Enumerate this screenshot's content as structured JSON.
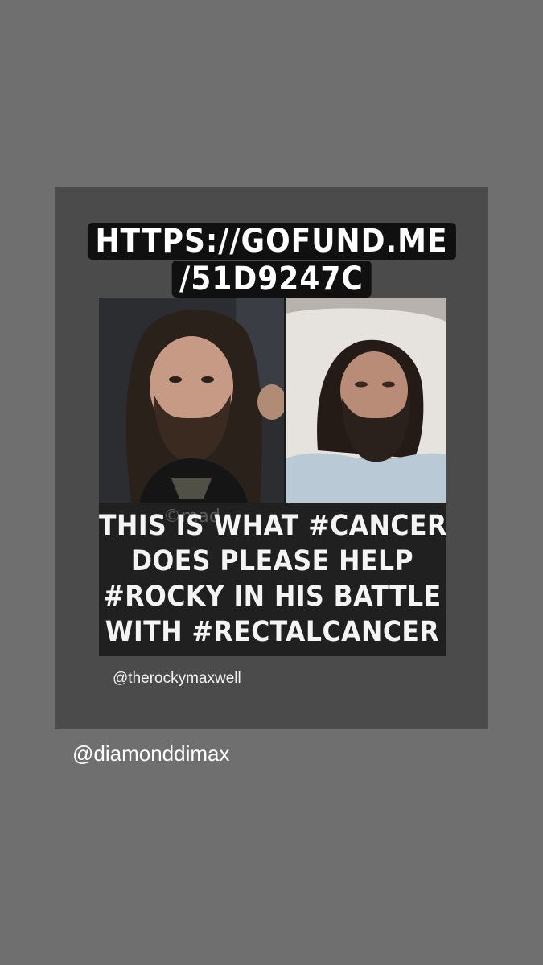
{
  "story": {
    "url_line_1": "HTTPS://GOFUND.ME",
    "url_line_2": "/51D9247C",
    "meme": {
      "caption_lines": [
        "THIS IS WHAT #CANCER",
        "DOES PLEASE HELP",
        "#ROCKY IN HIS BATTLE",
        "WITH #RECTALCANCER"
      ],
      "watermark": "©mad"
    },
    "handle_small": "@therockymaxwell",
    "handle_large": "@diamonddimax"
  },
  "colors": {
    "background": "#6f6f6f",
    "card": "#4b4b4b",
    "label_bg": "#101010",
    "caption_bg": "#202020"
  }
}
